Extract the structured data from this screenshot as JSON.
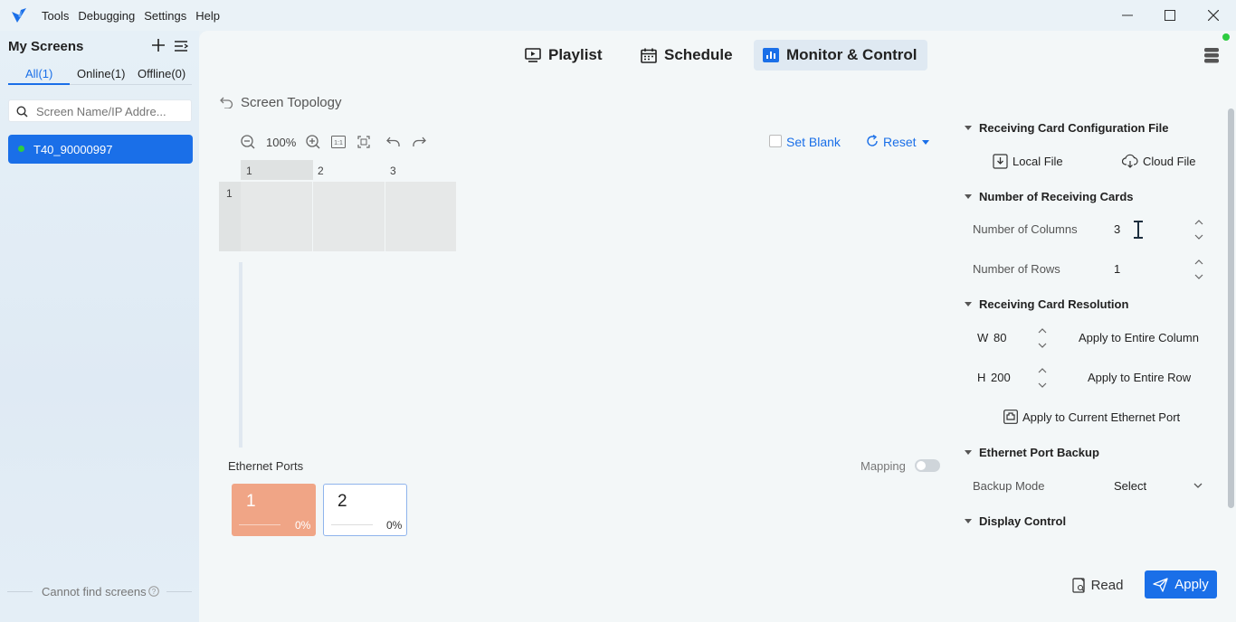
{
  "menu": {
    "tools": "Tools",
    "debugging": "Debugging",
    "settings": "Settings",
    "help": "Help"
  },
  "sidebar": {
    "title": "My Screens",
    "filters": [
      {
        "label": "All(1)"
      },
      {
        "label": "Online(1)"
      },
      {
        "label": "Offline(0)"
      }
    ],
    "search_placeholder": "Screen Name/IP Addre...",
    "screens": [
      {
        "name": "T40_90000997",
        "status": "online"
      }
    ],
    "footer": "Cannot find screens"
  },
  "nav": {
    "tabs": [
      {
        "label": "Playlist"
      },
      {
        "label": "Schedule"
      },
      {
        "label": "Monitor & Control"
      }
    ],
    "active": 2
  },
  "topology": {
    "back_label": "Screen Topology",
    "zoom": "100%",
    "set_blank": "Set Blank",
    "reset": "Reset",
    "columns": [
      "1",
      "2",
      "3"
    ],
    "rows": [
      "1"
    ]
  },
  "ports": {
    "title": "Ethernet Ports",
    "mapping_label": "Mapping",
    "mapping_on": false,
    "items": [
      {
        "num": "1",
        "pct": "0%",
        "active": true
      },
      {
        "num": "2",
        "pct": "0%",
        "active": false
      }
    ]
  },
  "config": {
    "section_file": "Receiving Card Configuration File",
    "local_file": "Local File",
    "cloud_file": "Cloud File",
    "section_count": "Number of Receiving Cards",
    "columns_label": "Number of Columns",
    "columns_value": "3",
    "rows_label": "Number of Rows",
    "rows_value": "1",
    "section_res": "Receiving Card Resolution",
    "w_label": "W",
    "w_value": "80",
    "h_label": "H",
    "h_value": "200",
    "apply_column": "Apply to Entire Column",
    "apply_row": "Apply to Entire Row",
    "apply_port": "Apply to Current Ethernet Port",
    "section_backup": "Ethernet Port Backup",
    "backup_label": "Backup Mode",
    "backup_value": "Select",
    "section_display": "Display Control"
  },
  "actions": {
    "read": "Read",
    "apply": "Apply"
  },
  "colors": {
    "accent": "#1a6fe8",
    "port_active": "#f0a586",
    "online": "#2ecc40"
  }
}
